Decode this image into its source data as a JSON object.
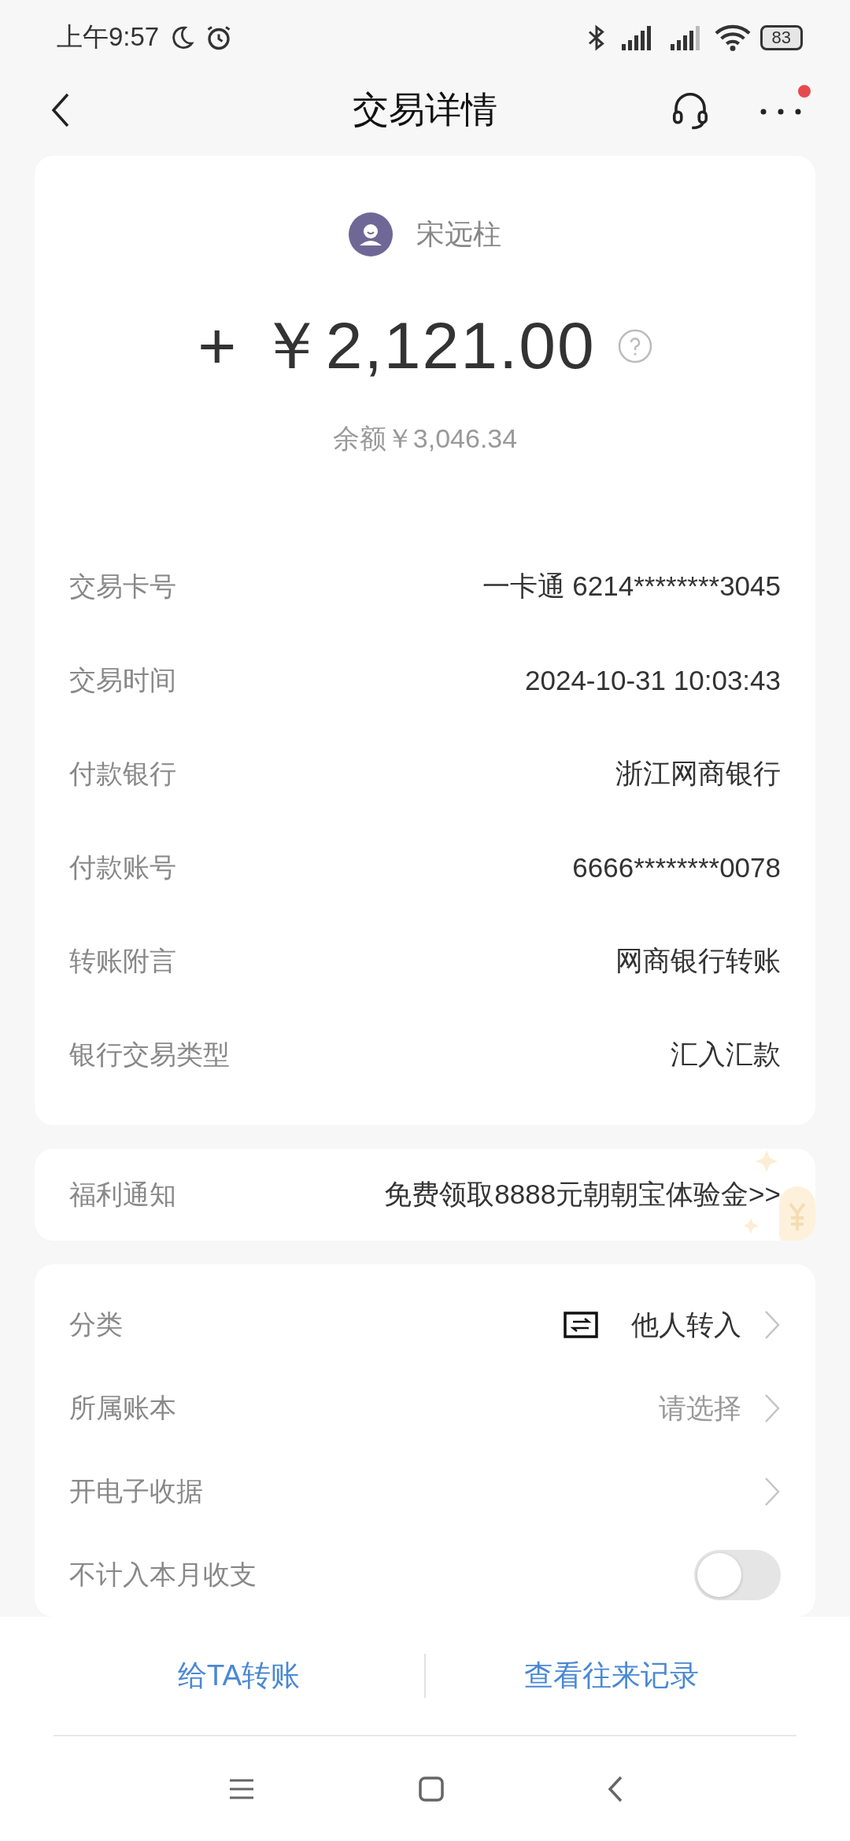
{
  "status_bar": {
    "time": "上午9:57",
    "battery": "83"
  },
  "header": {
    "title": "交易详情",
    "notification_dot": true
  },
  "summary": {
    "name": "宋远柱",
    "amount": "+ ￥2,121.00",
    "balance": "余额￥3,046.34"
  },
  "details": [
    {
      "label": "交易卡号",
      "value": "一卡通 6214********3045"
    },
    {
      "label": "交易时间",
      "value": "2024-10-31 10:03:43"
    },
    {
      "label": "付款银行",
      "value": "浙江网商银行"
    },
    {
      "label": "付款账号",
      "value": "6666********0078"
    },
    {
      "label": "转账附言",
      "value": "网商银行转账"
    },
    {
      "label": "银行交易类型",
      "value": "汇入汇款"
    }
  ],
  "promo": {
    "label": "福利通知",
    "text": "免费领取8888元朝朝宝体验金>>"
  },
  "settings": [
    {
      "kind": "category",
      "label": "分类",
      "value": "他人转入"
    },
    {
      "kind": "select",
      "label": "所属账本",
      "placeholder": "请选择"
    },
    {
      "kind": "link",
      "label": "开电子收据"
    },
    {
      "kind": "toggle",
      "label": "不计入本月收支",
      "on": false
    }
  ],
  "actions": [
    "给TA转账",
    "查看往来记录"
  ]
}
